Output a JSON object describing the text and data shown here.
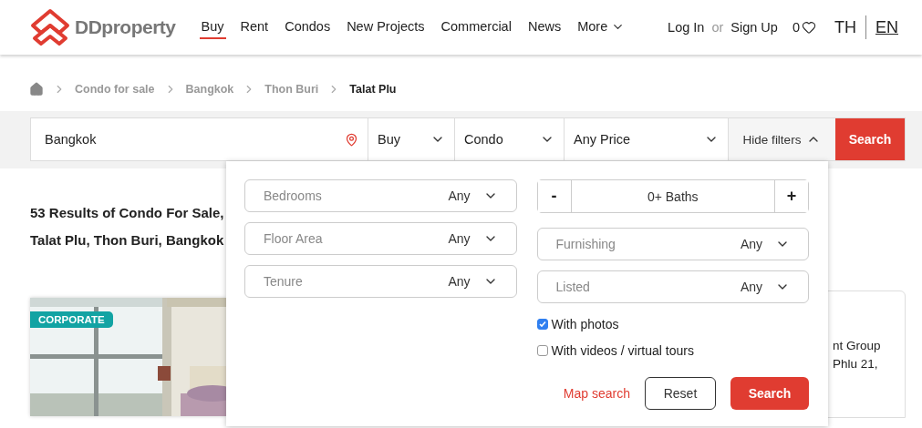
{
  "header": {
    "logo_text": "DDproperty",
    "nav": [
      {
        "label": "Buy",
        "selected": true,
        "dropdown": false
      },
      {
        "label": "Rent",
        "selected": false,
        "dropdown": false
      },
      {
        "label": "Condos",
        "selected": false,
        "dropdown": false
      },
      {
        "label": "New Projects",
        "selected": false,
        "dropdown": false
      },
      {
        "label": "Commercial",
        "selected": false,
        "dropdown": false
      },
      {
        "label": "News",
        "selected": false,
        "dropdown": false
      },
      {
        "label": "More",
        "selected": false,
        "dropdown": true
      }
    ],
    "login": "Log In",
    "or": "or",
    "signup": "Sign Up",
    "favorites_count": "0",
    "languages": [
      {
        "label": "TH",
        "selected": false
      },
      {
        "label": "EN",
        "selected": true
      }
    ]
  },
  "breadcrumb": [
    {
      "label": "Condo for sale",
      "current": false
    },
    {
      "label": "Bangkok",
      "current": false
    },
    {
      "label": "Thon Buri",
      "current": false
    },
    {
      "label": "Talat Plu",
      "current": true
    }
  ],
  "search_bar": {
    "location": "Bangkok",
    "selects": [
      "Buy",
      "Condo",
      "Any Price"
    ],
    "hide_filters": "Hide filters",
    "search": "Search"
  },
  "results": {
    "heading_lines": [
      "53 Results of Condo For Sale,",
      "Talat Plu, Thon Buri, Bangkok"
    ],
    "listing": {
      "badge": "CORPORATE",
      "side_lines": [
        "nt Group",
        "Phlu 21,"
      ]
    }
  },
  "filters": {
    "left": [
      {
        "label": "Bedrooms",
        "value": "Any"
      },
      {
        "label": "Floor Area",
        "value": "Any"
      },
      {
        "label": "Tenure",
        "value": "Any"
      }
    ],
    "baths": {
      "minus": "-",
      "value": "0+ Baths",
      "plus": "+"
    },
    "right": [
      {
        "label": "Furnishing",
        "value": "Any"
      },
      {
        "label": "Listed",
        "value": "Any"
      }
    ],
    "checkboxes": [
      {
        "label": "With photos",
        "checked": true
      },
      {
        "label": "With videos / virtual tours",
        "checked": false
      }
    ],
    "map_search": "Map search",
    "reset": "Reset",
    "search": "Search"
  }
}
